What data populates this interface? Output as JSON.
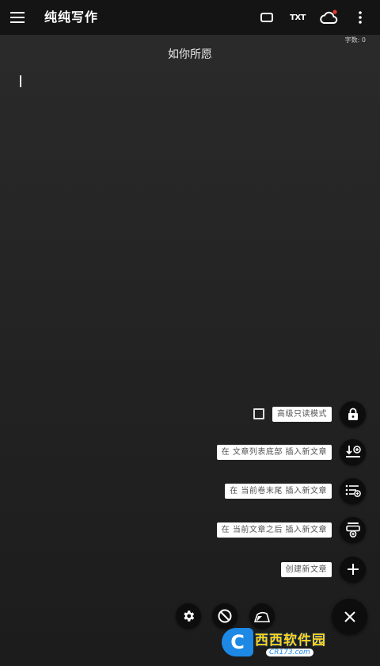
{
  "appbar": {
    "title": "纯纯写作",
    "txt_label": "TXT"
  },
  "editor": {
    "word_count": "字数: 0",
    "doc_title": "如你所愿"
  },
  "fab_menu": {
    "readonly_label": "高级只读模式",
    "insert_bottom_label": "在 文章列表底部 插入新文章",
    "insert_volume_end_label": "在 当前卷末尾 插入新文章",
    "insert_after_label": "在 当前文章之后 插入新文章",
    "create_label": "创建新文章"
  },
  "watermark": {
    "logo_letter": "C",
    "main": "西西软件园",
    "sub": "CR173.com"
  },
  "colors": {
    "appbar_bg": "#141414",
    "fab_bg": "#0d0d0d",
    "notification_dot": "#e53935",
    "watermark_blue": "#1e88e5",
    "watermark_yellow": "#ffd21e"
  },
  "icons": [
    "menu-icon",
    "fullscreen-icon",
    "cloud-sync-icon",
    "more-vert-icon",
    "lock-icon",
    "insert-bottom-icon",
    "list-add-icon",
    "insert-after-icon",
    "plus-icon",
    "settings-icon",
    "block-icon",
    "theme-icon",
    "close-icon"
  ]
}
